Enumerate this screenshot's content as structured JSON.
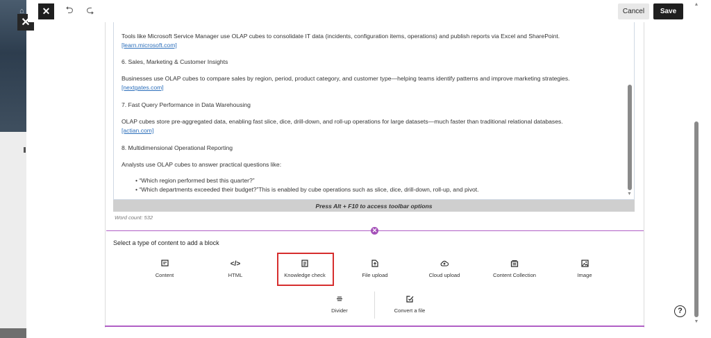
{
  "toolbar": {
    "cancel_label": "Cancel",
    "save_label": "Save"
  },
  "editor": {
    "paragraphs": [
      "Tools like Microsoft Service Manager use OLAP cubes to consolidate IT data (incidents, configuration items, operations) and publish reports via Excel and SharePoint.",
      "6. Sales, Marketing & Customer Insights",
      "Businesses use OLAP cubes to compare sales by region, period, product category, and customer type—helping teams identify patterns and improve marketing strategies.",
      "7. Fast Query Performance in Data Warehousing",
      "OLAP cubes store pre-aggregated data, enabling fast slice, dice, drill-down, and roll-up operations for large datasets—much faster than traditional relational databases.",
      "8. Multidimensional Operational Reporting",
      "Analysts use OLAP cubes to answer practical questions like:"
    ],
    "links": [
      "[learn.microsoft.com]",
      "[nextgates.com]",
      "[actian.com]"
    ],
    "bullets": [
      "“Which region performed best this quarter?”",
      "“Which departments exceeded their budget?”This is enabled by cube operations such as slice, dice, drill-down, roll-up, and pivot."
    ],
    "hint": "Press Alt + F10 to access toolbar options",
    "word_count": "Word count: 532"
  },
  "blocks": {
    "title": "Select a type of content to add a block",
    "row1": [
      {
        "label": "Content",
        "icon": "content-icon"
      },
      {
        "label": "HTML",
        "icon": "code-icon"
      },
      {
        "label": "Knowledge check",
        "icon": "knowledge-check-icon"
      },
      {
        "label": "File upload",
        "icon": "file-upload-icon"
      },
      {
        "label": "Cloud upload",
        "icon": "cloud-upload-icon"
      },
      {
        "label": "Content Collection",
        "icon": "content-collection-icon"
      },
      {
        "label": "Image",
        "icon": "image-icon"
      }
    ],
    "row2": [
      {
        "label": "Divider",
        "icon": "divider-icon"
      },
      {
        "label": "Convert a file",
        "icon": "convert-file-icon"
      }
    ]
  },
  "colors": {
    "accent_purple": "#a450b8",
    "selection_red": "#d62d2d",
    "link_blue": "#2c6fbb"
  }
}
